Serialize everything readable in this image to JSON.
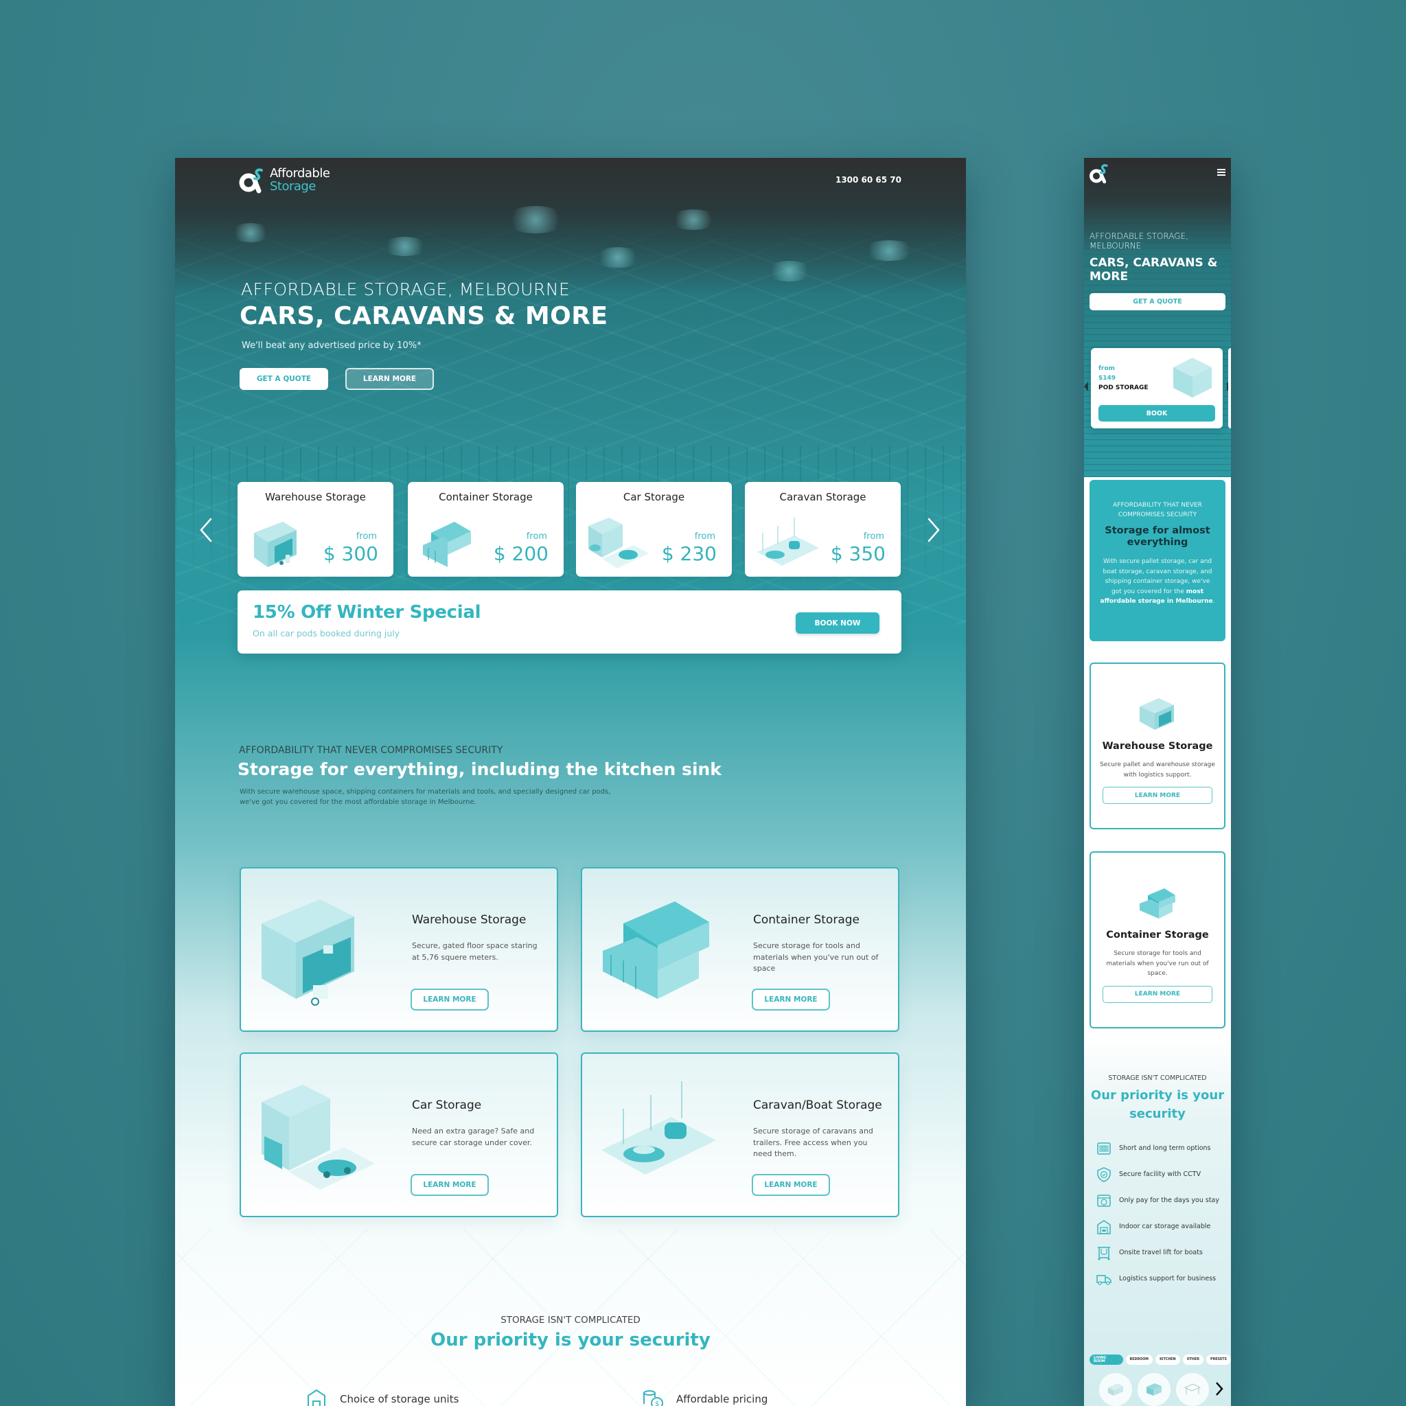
{
  "brand": {
    "name_line1": "Affordable",
    "name_line2": "Storage",
    "accent_color": "#34b6bf",
    "page_background": "#3d8790"
  },
  "desktop": {
    "header": {
      "phone": "1300 60 65 70"
    },
    "hero": {
      "subtitle": "AFFORDABLE STORAGE, MELBOURNE",
      "title": "CARS, CARAVANS & MORE",
      "tagline": "We'll beat any advertised price by 10%*",
      "primary_button": "GET A QUOTE",
      "secondary_button": "LEARN MORE"
    },
    "carousel": {
      "prev_icon": "chevron-left-icon",
      "next_icon": "chevron-right-icon",
      "cards": [
        {
          "title": "Warehouse Storage",
          "from_label": "from",
          "price": "$ 300",
          "icon": "warehouse-illustration"
        },
        {
          "title": "Container Storage",
          "from_label": "from",
          "price": "$ 200",
          "icon": "container-illustration"
        },
        {
          "title": "Car Storage",
          "from_label": "from",
          "price": "$ 230",
          "icon": "garage-car-illustration"
        },
        {
          "title": "Caravan Storage",
          "from_label": "from",
          "price": "$ 350",
          "icon": "caravan-boat-illustration"
        }
      ]
    },
    "promo": {
      "title": "15% Off Winter Special",
      "subtitle": "On all car pods booked during july",
      "button": "BOOK NOW"
    },
    "intro": {
      "eyebrow": "AFFORDABILITY THAT NEVER COMPROMISES SECURITY",
      "title": "Storage for everything, including the kitchen sink",
      "description": "With secure warehouse space, shipping containers for materials and tools, and specially designed car pods, we've got you covered for the most affordable storage in Melbourne."
    },
    "services": [
      {
        "title": "Warehouse Storage",
        "description": "Secure, gated floor space staring at 5,76 squere meters.",
        "button": "LEARN MORE"
      },
      {
        "title": "Container Storage",
        "description": "Secure storage for tools and materials when you've run out of space",
        "button": "LEARN MORE"
      },
      {
        "title": "Car Storage",
        "description": "Need an extra garage? Safe and secure car storage under cover.",
        "button": "LEARN MORE"
      },
      {
        "title": "Caravan/Boat Storage",
        "description": "Secure storage of caravans and trailers. Free access when you need them.",
        "button": "LEARN MORE"
      }
    ],
    "security": {
      "eyebrow": "STORAGE ISN'T COMPLICATED",
      "title": "Our priority is your security",
      "features": [
        {
          "label": "Choice of storage units",
          "icon": "storage-unit-icon"
        },
        {
          "label": "Affordable pricing",
          "icon": "coins-icon"
        }
      ]
    }
  },
  "mobile": {
    "header": {
      "menu_icon": "hamburger-menu-icon"
    },
    "hero": {
      "subtitle": "AFFORDABLE STORAGE, MELBOURNE",
      "title": "CARS, CARAVANS & MORE",
      "button": "GET A QUOTE"
    },
    "pod_card": {
      "from_label": "from",
      "price": "$149",
      "name": "POD STORAGE",
      "button": "BOOK"
    },
    "intro": {
      "eyebrow": "AFFORDABILITY THAT NEVER COMPROMISES SECURITY",
      "title": "Storage for almost everything",
      "description_plain": "With secure pallet storage, car and boat storage, caravan storage, and shipping container storage, we've got you covered for the ",
      "description_bold": "most affordable storage in Melbourne",
      "description_end": "."
    },
    "services": [
      {
        "title": "Warehouse Storage",
        "description": "Secure pallet and warehouse storage with logistics support.",
        "button": "LEARN MORE"
      },
      {
        "title": "Container Storage",
        "description": "Secure storage for tools and materials when you've run out of space.",
        "button": "LEARN MORE"
      }
    ],
    "security": {
      "eyebrow": "STORAGE ISN'T COMPLICATED",
      "title": "Our priority is your security",
      "features": [
        {
          "label": "Short and long term options",
          "icon": "calendar-icon"
        },
        {
          "label": "Secure facility with CCTV",
          "icon": "shield-check-icon"
        },
        {
          "label": "Only pay for the days you stay",
          "icon": "dollar-calendar-icon"
        },
        {
          "label": "Indoor car storage available",
          "icon": "garage-icon"
        },
        {
          "label": "Onsite travel lift for boats",
          "icon": "boat-lift-icon"
        },
        {
          "label": "Logistics support for business",
          "icon": "truck-icon"
        }
      ]
    },
    "room_tabs": [
      {
        "label": "LIVING ROOM",
        "active": true
      },
      {
        "label": "BEDROOM",
        "active": false
      },
      {
        "label": "KITCHEN",
        "active": false
      },
      {
        "label": "OTHER",
        "active": false
      },
      {
        "label": "PRESETS",
        "active": false
      }
    ],
    "room_items": [
      "cabinet-item",
      "dresser-item",
      "table-item"
    ]
  }
}
